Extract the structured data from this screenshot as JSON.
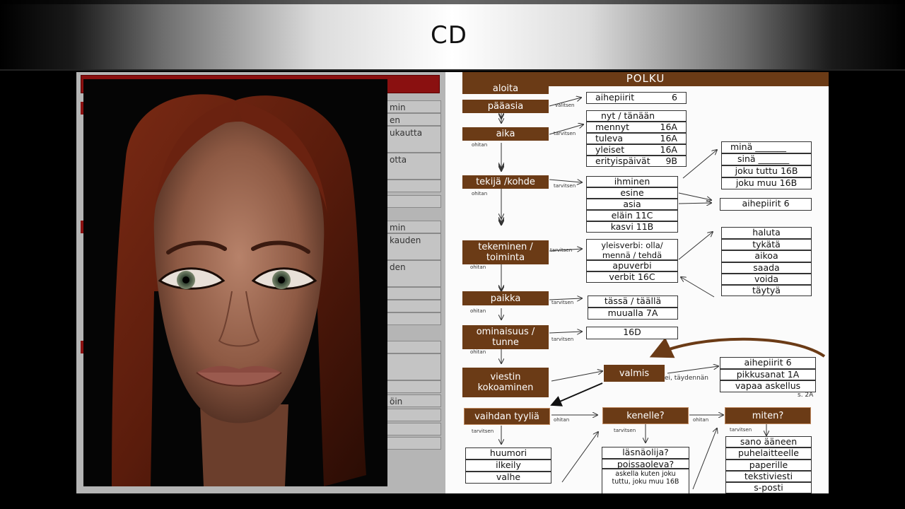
{
  "title": "CD",
  "form": {
    "rows": [
      "min",
      "en",
      "ukautta",
      "",
      "otta",
      "",
      "",
      "min",
      "kauden",
      "",
      "den",
      "",
      "",
      "",
      "",
      "",
      "",
      "öin",
      "",
      "",
      ""
    ]
  },
  "diagram": {
    "header": "POLKU",
    "steps": {
      "aloita": "aloita",
      "paaasia": "pääasia",
      "aika": "aika",
      "tekija": "tekijä /kohde",
      "tekeminen": "tekeminen / toiminta",
      "paikka": "paikka",
      "ominaisuus": "ominaisuus / tunne",
      "viestin": "viestin kokoaminen",
      "valmis": "valmis",
      "vaihdan": "vaihdan tyyliä",
      "kenelle": "kenelle?",
      "miten": "miten?"
    },
    "labels": {
      "valitsen": "valitsen",
      "tarvitsen": "tarvitsen",
      "ohitan": "ohitan",
      "ei_taydennan": "ei, täydennän",
      "s2a": "s. 2A"
    },
    "aihepiirit_top": {
      "name": "aihepiirit",
      "value": "6"
    },
    "aika_list": [
      {
        "name": "nyt   / tänään",
        "value": ""
      },
      {
        "name": "mennyt",
        "value": "16A"
      },
      {
        "name": "tuleva",
        "value": "16A"
      },
      {
        "name": "yleiset",
        "value": "16A"
      },
      {
        "name": "erityispäivät",
        "value": "9B"
      }
    ],
    "tekija_list": [
      "ihminen",
      "esine",
      "asia",
      "eläin 11C",
      "kasvi 11B"
    ],
    "pronoun_list": [
      "minä _______",
      "sinä _______",
      "joku tuttu 16B",
      "joku muu 16B"
    ],
    "aihepiirit_mid": "aihepiirit  6",
    "tekeminen_list": [
      "yleisverbi: olla/ mennä / tehdä",
      "apuverbi",
      "verbit  16C"
    ],
    "apuverbi_list": [
      "haluta",
      "tykätä",
      "aikoa",
      "saada",
      "voida",
      "täytyä"
    ],
    "paikka_list": [
      "tässä / täällä",
      "muualla 7A"
    ],
    "ominaisuus_list": [
      "16D"
    ],
    "valmis_list": [
      "aihepiirit  6",
      "pikkusanat 1A",
      "vapaa askellus"
    ],
    "tyyli_list": [
      "huumori",
      "ilkeily",
      "valhe"
    ],
    "kenelle_list": [
      "läsnäolija?",
      "poissaoleva?",
      "askella kuten joku tuttu, joku muu 16B"
    ],
    "miten_list": [
      "sano ääneen",
      "puhelaitteelle",
      "paperille",
      "tekstiviesti",
      "s-posti"
    ]
  }
}
